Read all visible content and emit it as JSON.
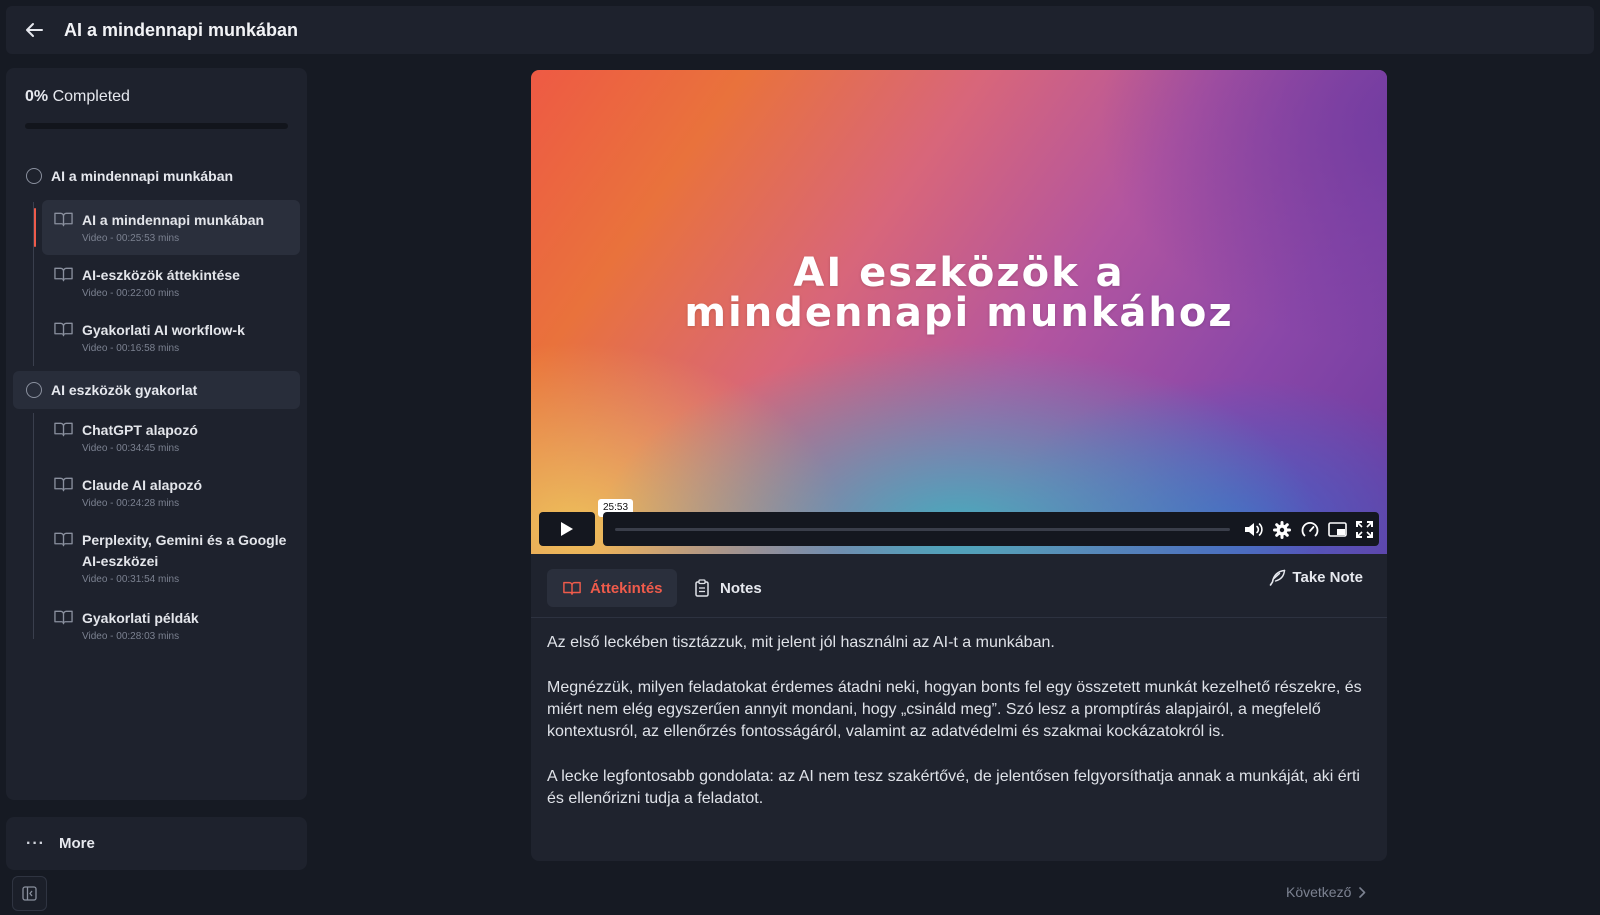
{
  "header": {
    "title": "AI a mindennapi munkában"
  },
  "sidebar": {
    "progress": {
      "percent_text": "0%",
      "label": "Completed",
      "value": 0
    },
    "sections": [
      {
        "title": "AI a mindennapi munkában",
        "lessons": [
          {
            "title": "AI a mindennapi munkában",
            "meta": "Video - 00:25:53 mins"
          },
          {
            "title": "AI-eszközök áttekintése",
            "meta": "Video - 00:22:00 mins"
          },
          {
            "title": "Gyakorlati AI workflow-k",
            "meta": "Video - 00:16:58 mins"
          }
        ]
      },
      {
        "title": "AI eszközök gyakorlat",
        "lessons": [
          {
            "title": "ChatGPT alapozó",
            "meta": "Video - 00:34:45 mins"
          },
          {
            "title": "Claude AI alapozó",
            "meta": "Video - 00:24:28 mins"
          },
          {
            "title": "Perplexity, Gemini és a Google AI-eszközei",
            "meta": "Video - 00:31:54 mins"
          },
          {
            "title": "Gyakorlati példák",
            "meta": "Video - 00:28:03 mins"
          }
        ]
      }
    ],
    "more_label": "More"
  },
  "video": {
    "title_line1": "AI eszközök a",
    "title_line2": "mindennapi munkához",
    "time_tooltip": "25:53"
  },
  "tabs": {
    "overview_label": "Áttekintés",
    "notes_label": "Notes",
    "take_note_label": "Take Note"
  },
  "overview": {
    "paragraphs": [
      "Az első leckében tisztázzuk, mit jelent jól használni az AI-t a munkában.",
      "Megnézzük, milyen feladatokat érdemes átadni neki, hogyan bonts fel egy összetett munkát kezelhető részekre, és miért nem elég egyszerűen annyit mondani, hogy „csináld meg”. Szó lesz a promptírás alapjairól, a megfelelő kontextusról, az ellenőrzés fontosságáról, valamint az adatvédelmi és szakmai kockázatokról is.",
      "A lecke legfontosabb gondolata: az AI nem tesz szakértővé, de jelentősen felgyorsíthatja annak a munkáját, aki érti és ellenőrizni tudja a feladatot."
    ]
  },
  "footer": {
    "next_label": "Következő"
  },
  "colors": {
    "accent": "#ef5b4b",
    "background": "#161a23",
    "panel": "#1e222d"
  },
  "icons": {
    "back": "arrow-left-icon",
    "lesson": "book-open-icon",
    "play": "play-icon",
    "volume": "volume-icon",
    "settings": "gear-icon",
    "speed": "speedometer-icon",
    "pip": "picture-in-picture-icon",
    "fullscreen": "fullscreen-icon",
    "notes": "clipboard-icon",
    "take_note": "feather-icon",
    "more": "ellipsis-icon",
    "collapse": "sidebar-collapse-icon",
    "next": "chevron-right-icon"
  }
}
